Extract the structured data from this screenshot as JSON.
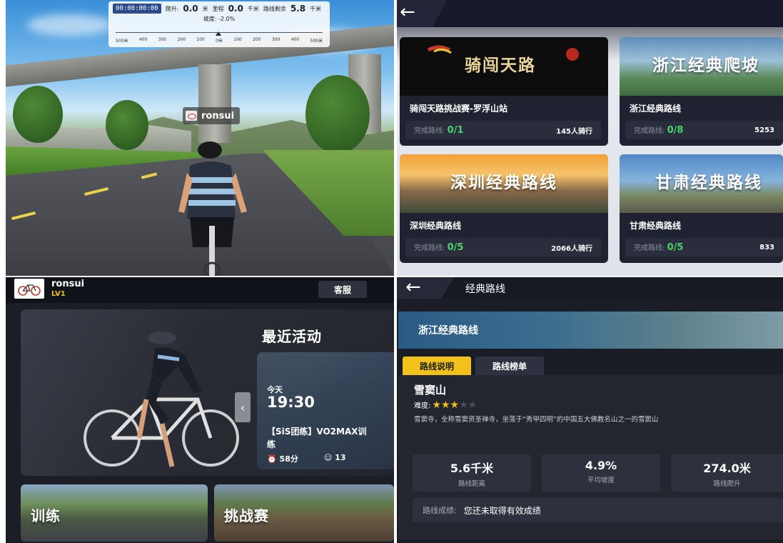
{
  "ride": {
    "hud": {
      "timer": "00:00:00:00",
      "climb_label": "爬升:",
      "climb_value": "0.0",
      "climb_unit": "米",
      "distance_label": "里程",
      "distance_value": "0.0",
      "distance_unit": "千米",
      "remaining_label": "路线剩余",
      "remaining_value": "5.8",
      "remaining_unit": "千米",
      "slope_label": "坡度:",
      "slope_value": "-2.0%",
      "scale_ticks": [
        "500米",
        "400",
        "300",
        "200",
        "100",
        "0米",
        "100",
        "200",
        "300",
        "400",
        "500米"
      ]
    },
    "player_name": "ronsui"
  },
  "route_list": {
    "cards": [
      {
        "banner_title": "骑闯天路",
        "name": "骑闯天路挑战赛-罗浮山站",
        "done_label": "完成路线:",
        "done_value": "0/1",
        "riders": "145人骑行"
      },
      {
        "banner_title": "浙江经典爬坡",
        "name": "浙江经典路线",
        "done_label": "完成路线:",
        "done_value": "0/8",
        "riders": "5253"
      },
      {
        "banner_title": "深圳经典路线",
        "name": "深圳经典路线",
        "done_label": "完成路线:",
        "done_value": "0/5",
        "riders": "2066人骑行"
      },
      {
        "banner_title": "甘肃经典路线",
        "name": "甘肃经典路线",
        "done_label": "完成路线:",
        "done_value": "0/5",
        "riders": "833"
      }
    ]
  },
  "home": {
    "username": "ronsui",
    "level": "LV1",
    "service_label": "客服",
    "recent_title": "最近活动",
    "event": {
      "day": "今天",
      "time": "19:30",
      "name_line1": "【SiS团练】VO2MAX训",
      "name_line2": "练",
      "duration": "58分",
      "participants": "13"
    },
    "tiles": [
      "训练",
      "挑战赛"
    ]
  },
  "detail": {
    "page_title": "经典路线",
    "banner_title": "浙江经典路线",
    "tabs": [
      "路线说明",
      "路线榜单"
    ],
    "route_name": "雪窦山",
    "difficulty_label": "难度:",
    "difficulty_stars": 3,
    "difficulty_max": 5,
    "description": "雪窦寺，全称雪窦资圣禅寺，坐落于“秀甲四明”的中国五大佛教名山之一的雪窦山",
    "metrics": [
      {
        "value": "5.6千米",
        "label": "路线距离"
      },
      {
        "value": "4.9%",
        "label": "平均坡度"
      },
      {
        "value": "274.0米",
        "label": "路线爬升"
      }
    ],
    "result_label": "路线成绩:",
    "result_value": "您还未取得有效成绩"
  },
  "colors": {
    "accent_yellow": "#f2c21b",
    "done_green": "#49d36a",
    "dark_bg": "#1b1d26"
  }
}
